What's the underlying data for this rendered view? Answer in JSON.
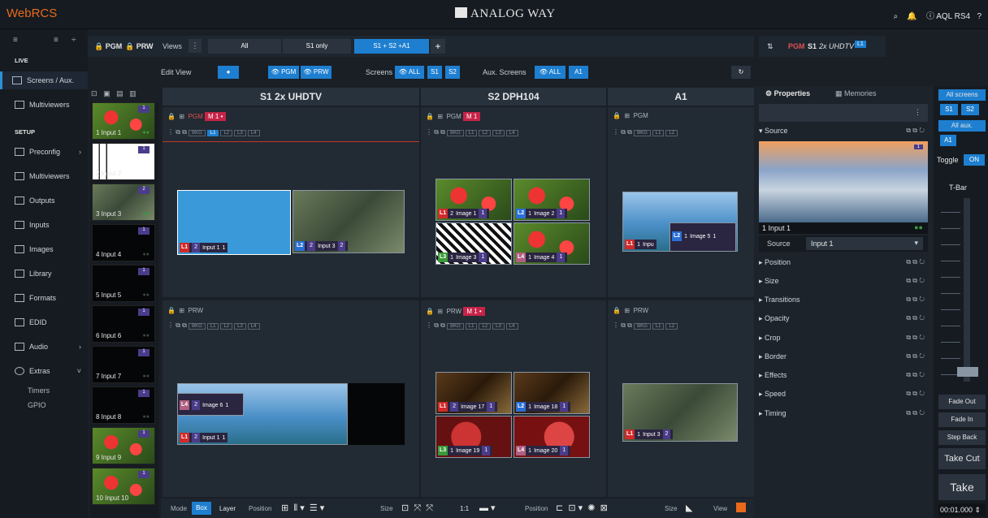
{
  "topbar": {
    "logo": "WebRCS",
    "brand": "ANALOG WAY",
    "device": "AQL RS4"
  },
  "sidebar": {
    "sec_live": "LIVE",
    "screens": "Screens / Aux.",
    "multiviewers": "Multiviewers",
    "sec_setup": "SETUP",
    "preconfig": "Preconfig",
    "multiviewers2": "Multiviewers",
    "outputs": "Outputs",
    "inputs": "Inputs",
    "images": "Images",
    "library": "Library",
    "formats": "Formats",
    "edid": "EDID",
    "audio": "Audio",
    "extras": "Extras",
    "timers": "Timers",
    "gpio": "GPIO"
  },
  "toolbar": {
    "pgm": "PGM",
    "prw": "PRW",
    "views": "Views",
    "all": "All",
    "s1only": "S1 only",
    "combo": "S1 + S2 +A1",
    "edit_view": "Edit View",
    "eye_pgm": "PGM",
    "eye_prw": "PRW",
    "screens_label": "Screens",
    "screens_all": "ALL",
    "s1": "S1",
    "s2": "S2",
    "aux_label": "Aux. Screens",
    "aux_all": "ALL",
    "a1": "A1"
  },
  "inputs": [
    {
      "label": "1 Input 1",
      "n": "1"
    },
    {
      "label": "2 Input 2",
      "n": "1"
    },
    {
      "label": "3 Input 3",
      "n": "2"
    },
    {
      "label": "4 Input 4",
      "n": "1"
    },
    {
      "label": "5 Input 5",
      "n": "1"
    },
    {
      "label": "6 Input 6",
      "n": "1"
    },
    {
      "label": "7 Input 7",
      "n": "1"
    },
    {
      "label": "8 Input 8",
      "n": "1"
    },
    {
      "label": "9 Input 9",
      "n": "1"
    },
    {
      "label": "10 Input 10",
      "n": "1"
    }
  ],
  "screens": {
    "s1": {
      "title": "S1 2x UHDTV",
      "pgm": "PGM",
      "m": "M 1 •",
      "prw": "PRW",
      "bkg": "BKG",
      "l1": "L1",
      "l2": "L2",
      "l3": "L3",
      "l4": "L4"
    },
    "s2": {
      "title": "S2 DPH104",
      "pgm": "PGM",
      "m": "M 1",
      "prw": "PRW",
      "m2": "M 1 •"
    },
    "a1": {
      "title": "A1",
      "pgm": "PGM",
      "prw": "PRW"
    }
  },
  "layers": {
    "s1_pgm": [
      {
        "tag": "L1",
        "n": "2",
        "name": "Input 1",
        "v": "1"
      },
      {
        "tag": "L2",
        "n": "2",
        "name": "Input 3",
        "v": "2"
      }
    ],
    "s2_pgm": [
      {
        "tag": "L1",
        "n": "2",
        "name": "Image 1",
        "v": "1"
      },
      {
        "tag": "L2",
        "n": "1",
        "name": "Image 2",
        "v": "1"
      },
      {
        "tag": "L3",
        "n": "1",
        "name": "Image 3",
        "v": "1"
      },
      {
        "tag": "L4",
        "n": "1",
        "name": "Image 4",
        "v": "1"
      }
    ],
    "a1_pgm": [
      {
        "tag": "L1",
        "n": "1",
        "name": "Inpu",
        "v": "1"
      },
      {
        "tag": "L2",
        "n": "1",
        "name": "Image 5",
        "v": "1"
      }
    ],
    "s1_prw": [
      {
        "tag": "L4",
        "n": "2",
        "name": "Image 6",
        "v": "1"
      },
      {
        "tag": "L1",
        "n": "2",
        "name": "Input 1",
        "v": "1"
      }
    ],
    "s2_prw": [
      {
        "tag": "L1",
        "n": "2",
        "name": "Image 17",
        "v": "1"
      },
      {
        "tag": "L2",
        "n": "1",
        "name": "Image 18",
        "v": "1"
      },
      {
        "tag": "L3",
        "n": "1",
        "name": "Image 19",
        "v": "1"
      },
      {
        "tag": "L4",
        "n": "1",
        "name": "Image 20",
        "v": "1"
      }
    ],
    "a1_prw": [
      {
        "tag": "L1",
        "n": "1",
        "name": "Input 3",
        "v": "2"
      }
    ]
  },
  "right_header": {
    "pgm": "PGM",
    "s1": "S1",
    "mode": "2x UHDTV",
    "l1": "L1"
  },
  "props": {
    "tab_properties": "Properties",
    "tab_memories": "Memories",
    "source_section": "Source",
    "preview_label": "1 Input 1",
    "source_label": "Source",
    "source_value": "Input 1",
    "sections": [
      "Position",
      "Size",
      "Transitions",
      "Opacity",
      "Crop",
      "Border",
      "Effects",
      "Speed",
      "Timing"
    ]
  },
  "rbar": {
    "all_screens": "All screens",
    "s1": "S1",
    "s2": "S2",
    "all_aux": "All aux.",
    "a1": "A1",
    "toggle": "Toggle",
    "on": "ON",
    "tbar": "T-Bar",
    "fade_out": "Fade Out",
    "fade_in": "Fade In",
    "step_back": "Step Back",
    "take_cut": "Take Cut",
    "take": "Take",
    "time": "00:01.000"
  },
  "bottom": {
    "mode": "Mode",
    "box": "Box",
    "layer": "Layer",
    "position": "Position",
    "size": "Size",
    "one": "1:1",
    "position2": "Position",
    "size2": "Size",
    "view": "View"
  }
}
